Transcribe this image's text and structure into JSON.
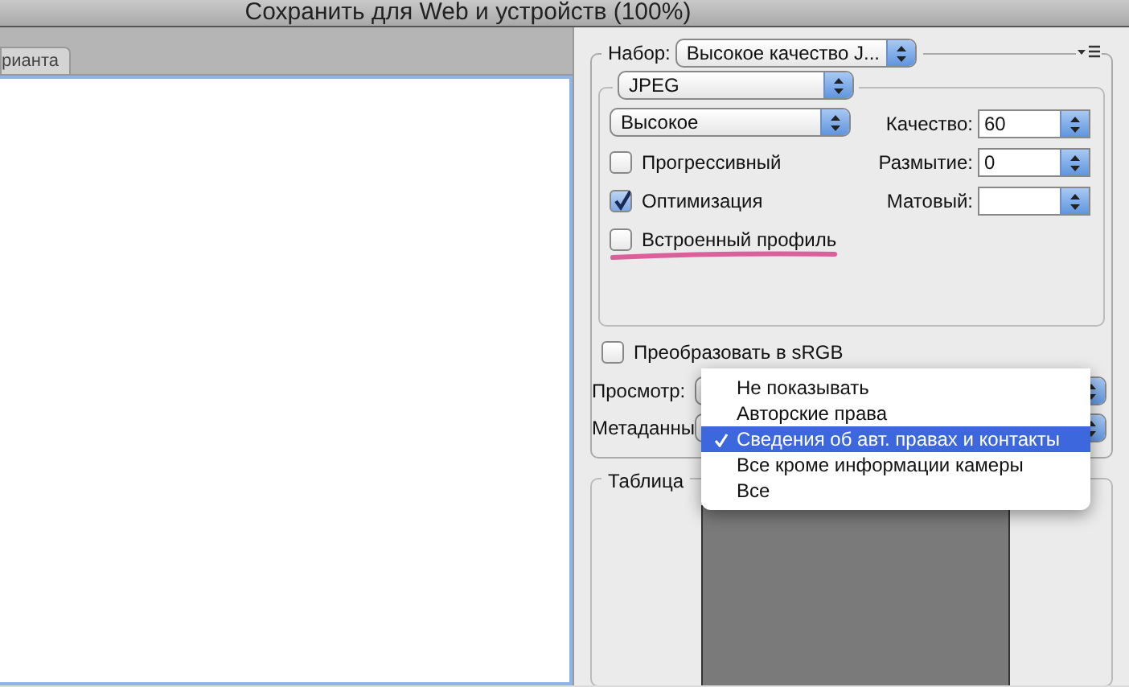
{
  "window": {
    "title": "Сохранить для Web и устройств (100%)"
  },
  "tabs": [
    {
      "label": "рианта",
      "selected": false
    }
  ],
  "preset": {
    "label": "Набор:",
    "value": "Высокое качество J..."
  },
  "format": {
    "value": "JPEG"
  },
  "quality_preset": {
    "value": "Высокое"
  },
  "checkboxes": [
    {
      "label": "Прогрессивный",
      "checked": false,
      "highlighted": false
    },
    {
      "label": "Оптимизация",
      "checked": true,
      "highlighted": false
    },
    {
      "label": "Встроенный профиль",
      "checked": false,
      "highlighted": true
    }
  ],
  "fields": [
    {
      "label": "Качество:",
      "value": "60"
    },
    {
      "label": "Размытие:",
      "value": "0"
    },
    {
      "label": "Матовый:"
    }
  ],
  "convert_srgb": {
    "label": "Преобразовать в sRGB",
    "checked": false
  },
  "preview": {
    "label": "Просмотр:"
  },
  "metadata": {
    "label": "Метаданны"
  },
  "color_table": {
    "title": "Таблица"
  },
  "metadata_menu": [
    {
      "label": "Не показывать",
      "selected": false
    },
    {
      "label": "Авторские права",
      "selected": false
    },
    {
      "label": "Сведения об авт. правах и контакты",
      "selected": true
    },
    {
      "label": "Все кроме информации камеры",
      "selected": false
    },
    {
      "label": "Все",
      "selected": false
    }
  ]
}
